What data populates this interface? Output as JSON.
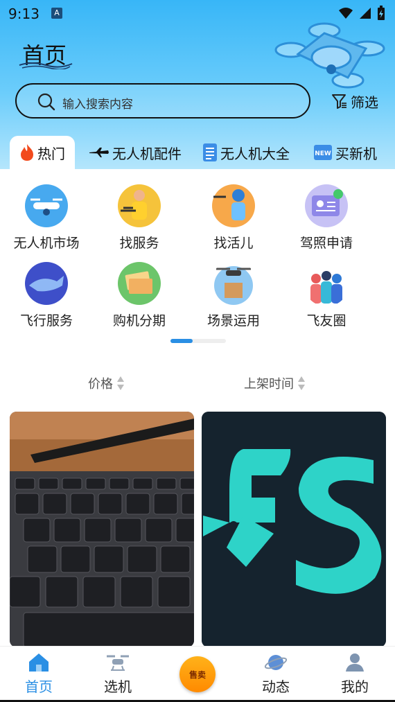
{
  "status_bar": {
    "time": "9:13",
    "notif_icon": "A"
  },
  "header": {
    "title": "首页",
    "search_placeholder": "输入搜索内容",
    "filter_label": "筛选"
  },
  "tabs": [
    {
      "label": "热门",
      "icon": "fire-icon"
    },
    {
      "label": "无人机配件",
      "icon": "plane-icon"
    },
    {
      "label": "无人机大全",
      "icon": "document-icon"
    },
    {
      "label": "买新机",
      "icon": "new-badge-icon"
    }
  ],
  "categories": [
    {
      "label": "无人机市场",
      "icon": "drone-market-icon"
    },
    {
      "label": "找服务",
      "icon": "service-person-icon"
    },
    {
      "label": "找活儿",
      "icon": "courier-icon"
    },
    {
      "label": "驾照申请",
      "icon": "license-card-icon"
    },
    {
      "label": "飞行服务",
      "icon": "whale-icon"
    },
    {
      "label": "购机分期",
      "icon": "money-stack-icon"
    },
    {
      "label": "场景运用",
      "icon": "drone-delivery-icon"
    },
    {
      "label": "飞友圈",
      "icon": "group-people-icon"
    }
  ],
  "sort": {
    "price": "价格",
    "listing_time": "上架时间"
  },
  "bottom_nav": {
    "home": "首页",
    "select": "选机",
    "sell": "售卖",
    "feed": "动态",
    "mine": "我的"
  },
  "colors": {
    "accent": "#2a8fe4",
    "header_top": "#38b6f7",
    "sell": "#ff9a0a"
  }
}
